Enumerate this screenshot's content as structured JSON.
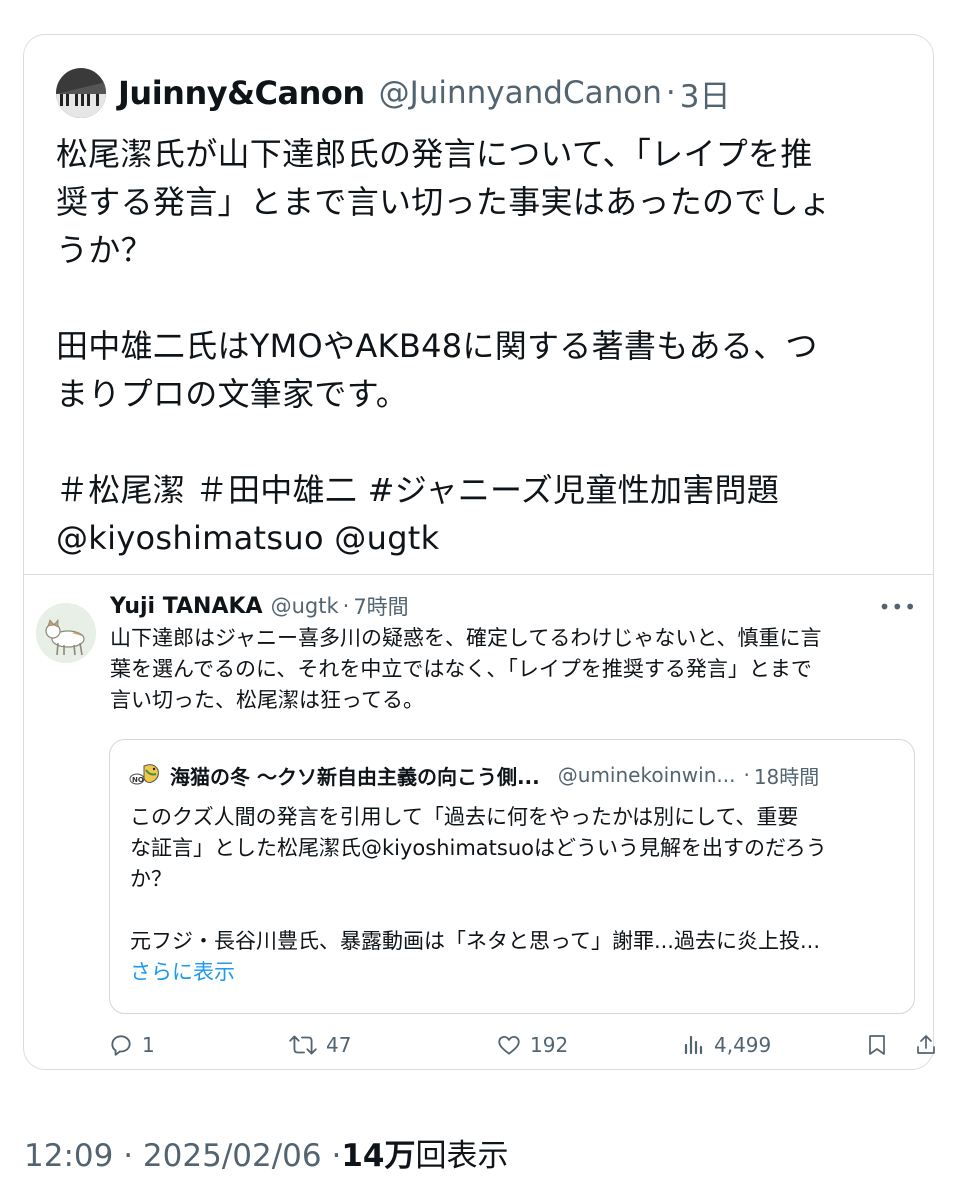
{
  "tweet": {
    "display_name": "Juinny&Canon",
    "handle": "@JuinnyandCanon",
    "separator": "·",
    "age": "3日",
    "text_lines": [
      "松尾潔氏が山下達郎氏の発言について、「レイプを推",
      "奨する発言」とまで言い切った事実はあったのでしょ",
      "うか？",
      "",
      "田中雄二氏はYMOやAKB48に関する著書もある、つ",
      "まりプロの文筆家です。",
      "",
      "＃松尾潔 ＃田中雄二 #ジャニーズ児童性加害問題",
      "@kiyoshimatsuo @ugtk"
    ]
  },
  "quoted": {
    "display_name": "Yuji TANAKA",
    "handle": "@ugtk",
    "separator": "·",
    "age": "7時間",
    "more_icon": "•••",
    "text_lines": [
      "山下達郎はジャニー喜多川の疑惑を、確定してるわけじゃないと、慎重に言",
      "葉を選んでるのに、それを中立ではなく、「レイプを推奨する発言」とまで",
      "言い切った、松尾潔は狂ってる。"
    ],
    "inner": {
      "display_name": "海猫の冬 〜クソ新自由主義の向こう側...",
      "handle": "@uminekoinwin...",
      "separator": "·",
      "age": "18時間",
      "text_lines": [
        "このクズ人間の発言を引用して「過去に何をやったかは別にして、重要",
        "な証言」とした松尾潔氏@kiyoshimatsuoはどういう見解を出すのだろう",
        "か？",
        "",
        "元フジ・長谷川豊氏、暴露動画は「ネタと思って」謝罪...過去に炎上投..."
      ],
      "show_more": "さらに表示"
    },
    "actions": {
      "replies": "1",
      "retweets": "47",
      "likes": "192",
      "views": "4,499"
    }
  },
  "footer": {
    "time": "12:09",
    "date": "2025/02/06",
    "separator": "·",
    "views_count": "14万",
    "views_label": "回表示"
  },
  "colors": {
    "text": "#0f1419",
    "secondary": "#536471",
    "link": "#1d9bf0",
    "border": "#d9dde1"
  }
}
